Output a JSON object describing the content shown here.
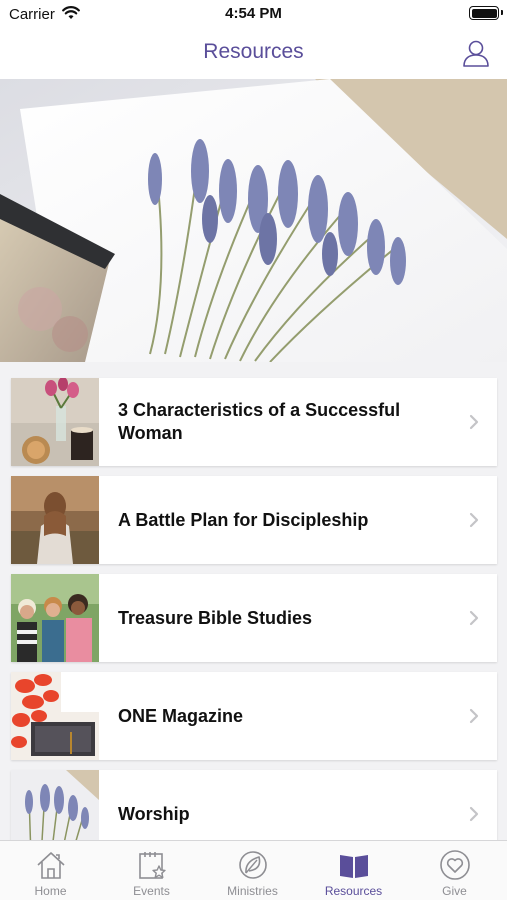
{
  "status_bar": {
    "carrier": "Carrier",
    "time": "4:54 PM"
  },
  "nav": {
    "title": "Resources",
    "profile_icon": "user-icon"
  },
  "hero": {
    "icon": "lavender-photo"
  },
  "resources": [
    {
      "title": "3 Characteristics of a Successful Woman",
      "thumb": "flowers-coffee-photo"
    },
    {
      "title": "A Battle Plan for Discipleship",
      "thumb": "woman-field-photo"
    },
    {
      "title": "Treasure Bible Studies",
      "thumb": "women-group-photo"
    },
    {
      "title": "ONE Magazine",
      "thumb": "red-leaves-laptop-photo"
    },
    {
      "title": "Worship",
      "thumb": "lavender-photo"
    }
  ],
  "tabs": [
    {
      "label": "Home",
      "icon": "home-icon"
    },
    {
      "label": "Events",
      "icon": "calendar-star-icon"
    },
    {
      "label": "Ministries",
      "icon": "leaf-icon"
    },
    {
      "label": "Resources",
      "icon": "book-icon",
      "active": true
    },
    {
      "label": "Give",
      "icon": "heart-circle-icon"
    }
  ],
  "colors": {
    "accent": "#5a4e9a",
    "inactive": "#8e8e93"
  }
}
